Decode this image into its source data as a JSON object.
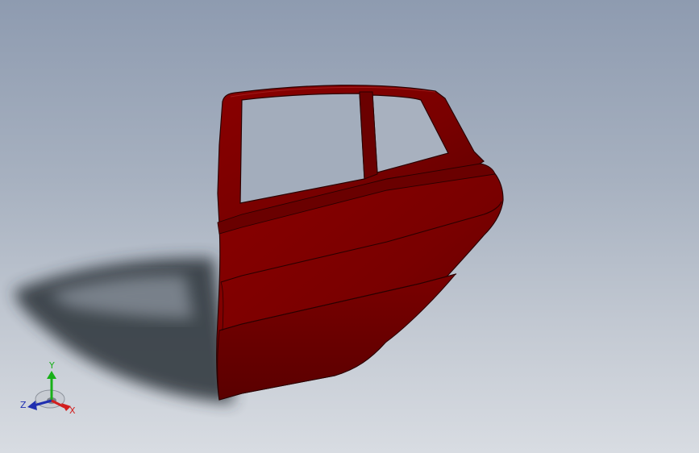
{
  "viewport": {
    "background_top": "#8e9bb0",
    "background_bottom": "#d8dce2"
  },
  "model": {
    "part": "rear car door",
    "color": "#7d0000",
    "shade_color": "#5e0000",
    "edge_color": "#2a0000"
  },
  "triad": {
    "x_label": "X",
    "y_label": "Y",
    "z_label": "Z",
    "x_color": "#d21e1e",
    "y_color": "#18b018",
    "z_color": "#1f2fb0"
  }
}
